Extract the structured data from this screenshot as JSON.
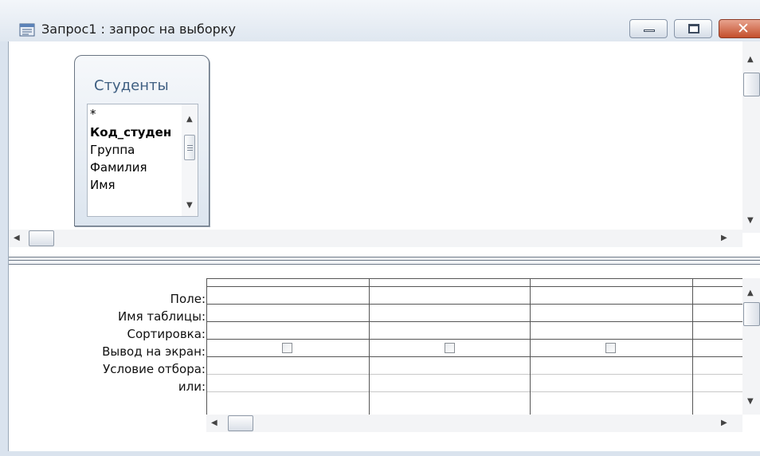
{
  "window": {
    "title": "Запрос1 : запрос на выборку",
    "icon": "query-icon",
    "controls": [
      "minimize-icon",
      "maximize-icon",
      "close-icon"
    ]
  },
  "table": {
    "title": "Студенты",
    "fields": [
      "*",
      "Код_студен",
      "Группа",
      "Фамилия",
      "Имя"
    ]
  },
  "grid": {
    "rows": [
      "Поле:",
      "Имя таблицы:",
      "Сортировка:",
      "Вывод на экран:",
      "Условие отбора:",
      "или:"
    ],
    "columns": [
      {
        "field": "",
        "table": "",
        "sort": "",
        "show": false,
        "criteria": "",
        "or": ""
      },
      {
        "field": "",
        "table": "",
        "sort": "",
        "show": false,
        "criteria": "",
        "or": ""
      },
      {
        "field": "",
        "table": "",
        "sort": "",
        "show": false,
        "criteria": "",
        "or": ""
      },
      {
        "field": "",
        "table": "",
        "sort": "",
        "show": false,
        "criteria": "",
        "or": ""
      }
    ]
  },
  "colors": {
    "title_text": "#1e1e1e",
    "table_title": "#3f5f82",
    "close_button": "#c44f2c"
  }
}
